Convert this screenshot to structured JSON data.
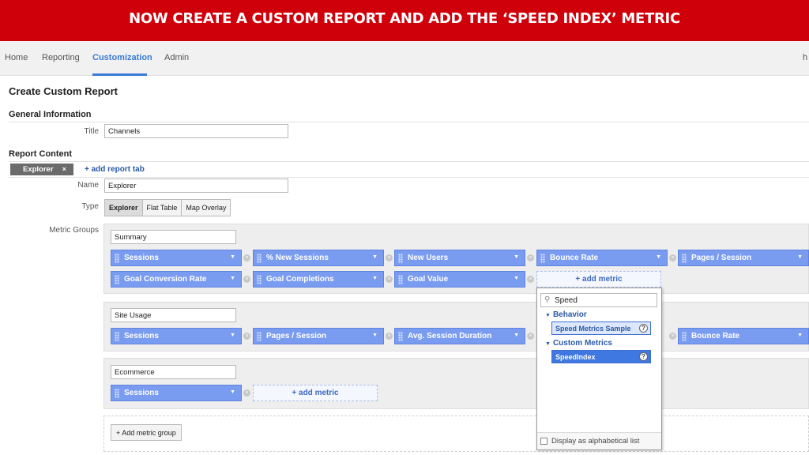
{
  "banner": {
    "text": "NOW CREATE A CUSTOM REPORT AND ADD THE ‘SPEED INDEX’ METRIC"
  },
  "nav": {
    "items": [
      "Home",
      "Reporting",
      "Customization",
      "Admin"
    ],
    "active": "Customization",
    "user_partial": "h"
  },
  "page": {
    "title": "Create Custom Report",
    "general_heading": "General Information",
    "title_label": "Title",
    "title_value": "Channels",
    "report_content_heading": "Report Content",
    "tab_label": "Explorer",
    "tab_close": "×",
    "add_tab_link": "+ add report tab",
    "name_label": "Name",
    "name_value": "Explorer",
    "type_label": "Type",
    "types": [
      "Explorer",
      "Flat Table",
      "Map Overlay"
    ],
    "selected_type": "Explorer",
    "metric_groups_label": "Metric Groups"
  },
  "groups": [
    {
      "name": "Summary",
      "row1": [
        "Sessions",
        "% New Sessions",
        "New Users",
        "Bounce Rate",
        "Pages / Session"
      ],
      "row2": [
        "Goal Conversion Rate",
        "Goal Completions",
        "Goal Value"
      ],
      "add_metric": "+ add metric"
    },
    {
      "name": "Site Usage",
      "row1": [
        "Sessions",
        "Pages / Session",
        "Avg. Session Duration",
        "",
        "Bounce Rate"
      ]
    },
    {
      "name": "Ecommerce",
      "row1": [
        "Sessions"
      ],
      "add_metric": "+ add metric"
    }
  ],
  "add_metric_group": "+ Add metric group",
  "dropdown": {
    "search_value": "Speed",
    "categories": [
      {
        "name": "Behavior",
        "item": "Speed Metrics Sample",
        "highlight": "#dce7fb"
      },
      {
        "name": "Custom Metrics",
        "item": "SpeedIndex",
        "highlight": "#3e78e0"
      }
    ],
    "alpha_label": "Display as alphabetical list"
  },
  "colors": {
    "banner": "#d0000a",
    "accent": "#3a7bd5",
    "pill": "#7a9cf0",
    "link": "#2b59a8"
  },
  "icons": {
    "search": "search-icon",
    "remove": "remove-icon",
    "caret": "chevron-down-icon",
    "help": "help-icon",
    "grip": "drag-handle-icon"
  }
}
